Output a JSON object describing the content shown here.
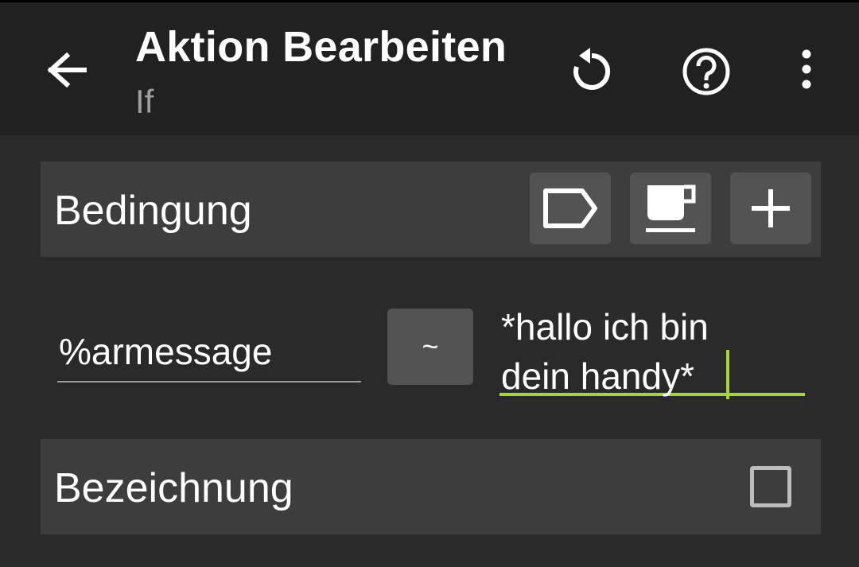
{
  "appbar": {
    "title": "Aktion Bearbeiten",
    "subtitle": "If",
    "icons": {
      "back": "arrow-back-icon",
      "undo": "undo-icon",
      "help": "help-icon",
      "more": "more-vertical-icon"
    }
  },
  "condition": {
    "label": "Bedingung",
    "buttons": [
      "label-tag-icon",
      "coffee-cup-icon",
      "plus-icon"
    ],
    "variable": "%armessage",
    "operator": "~",
    "value_line1": "*hallo ich bin",
    "value_line2": "dein handy*"
  },
  "label_section": {
    "label": "Bezeichnung",
    "checked": false
  },
  "colors": {
    "appbar_bg": "#212121",
    "page_bg": "#2a2a2a",
    "section_bg": "#3d3d3d",
    "button_bg": "#535353",
    "accent": "#a6d62c",
    "subtitle": "#9e9e9e"
  }
}
